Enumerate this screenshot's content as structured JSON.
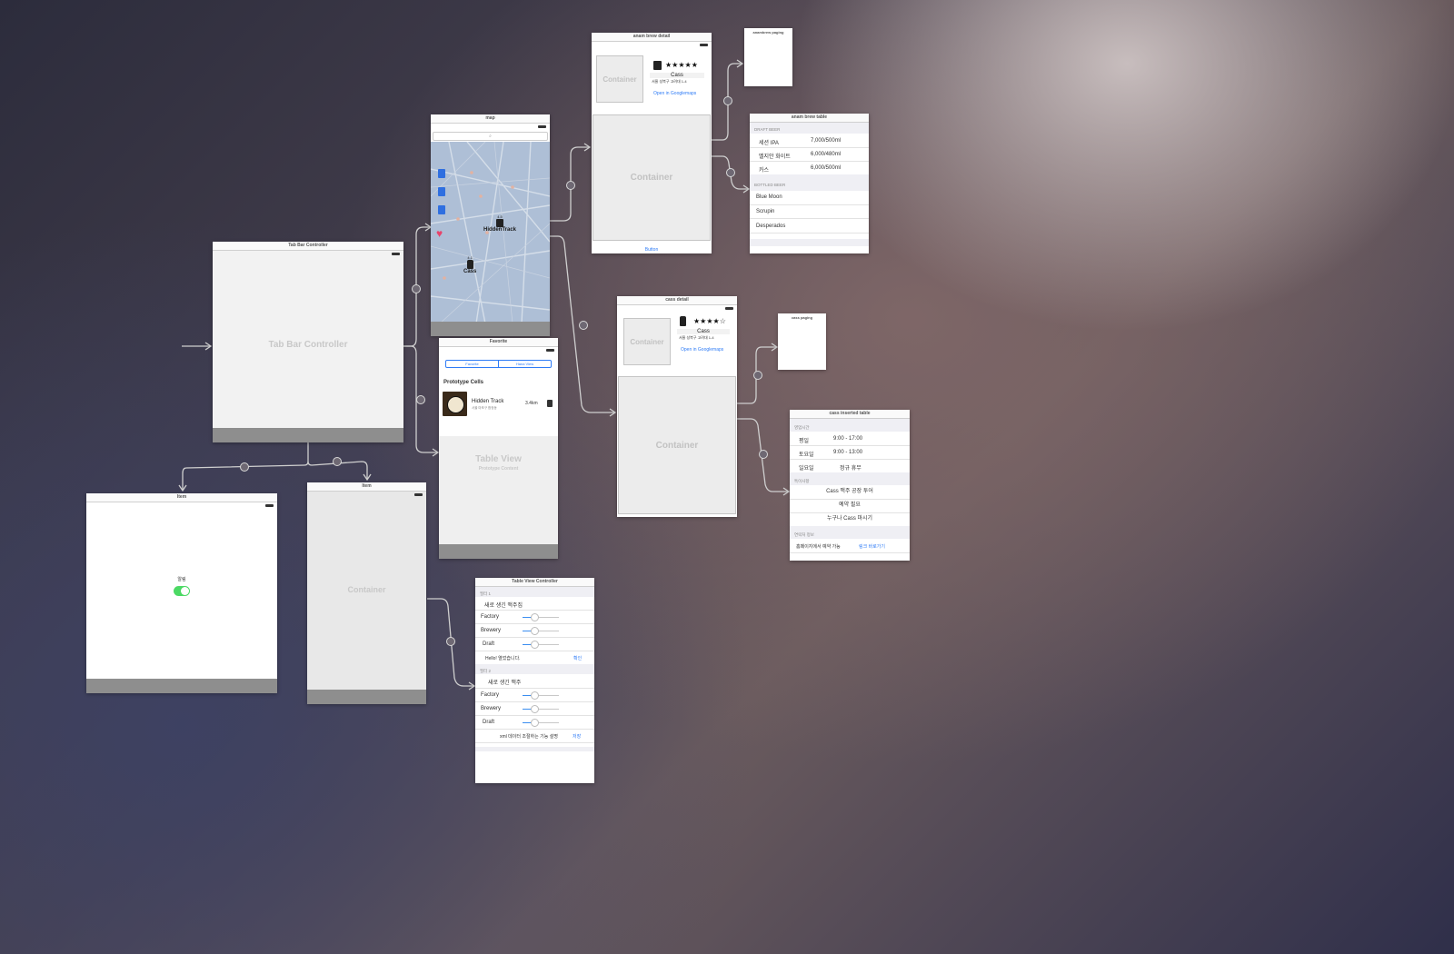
{
  "tab_bar_controller": {
    "title": "Tab Bar Controller",
    "center_label": "Tab Bar Controller"
  },
  "item_settings": {
    "title": "Item",
    "label": "알림",
    "toggle_on": true,
    "toggle_color": "#4cd964"
  },
  "item_container": {
    "title": "Item",
    "container_label": "Container"
  },
  "map": {
    "title": "map",
    "search_icon": "search-icon",
    "pins": [
      {
        "rating": "4.5",
        "name": "HiddenTrack",
        "icon": "beer-glass-icon"
      },
      {
        "rating": "4.1",
        "name": "Cass",
        "icon": "bottle-icon"
      }
    ],
    "heart_icon": "heart-icon",
    "heart_color": "#e8436b"
  },
  "favorite": {
    "title": "Favorite",
    "segments": [
      "Favorite",
      "Hana View"
    ],
    "prototype_cells": "Prototype Cells",
    "cell": {
      "name": "Hidden Track",
      "subtitle": "서울 마포구 합정동",
      "distance": "3.4km",
      "rank": "0"
    },
    "table_view_label": "Table View",
    "table_view_sub": "Prototype Content"
  },
  "anambrew_detail": {
    "title": "anam brew detail",
    "container_label": "Container",
    "rating_stars": "★★★★★",
    "beer_name": "Cass",
    "address": "서울 성북구 고려대 1-4",
    "open_link": "Open in Googlemaps",
    "lower_container_label": "Container",
    "bottom_button": "Button"
  },
  "anambrew_paging": {
    "title": "anambrew paging"
  },
  "anambrew_table": {
    "title": "anam brew table",
    "sections": [
      {
        "header": "DRAFT BEER",
        "rows": [
          [
            "세션 IPA",
            "7,000/500ml"
          ],
          [
            "벨지안 화이트",
            "6,000/480ml"
          ],
          [
            "카스",
            "6,000/500ml"
          ]
        ]
      },
      {
        "header": "BOTTLED BEER",
        "rows": [
          [
            "Blue Moon",
            ""
          ],
          [
            "Scrupin",
            ""
          ],
          [
            "Desperados",
            ""
          ]
        ]
      }
    ]
  },
  "cass_detail": {
    "title": "cass detail",
    "container_label": "Container",
    "rating_stars": "★★★★☆",
    "beer_name": "Cass",
    "address": "서울 성북구 고려대 1-4",
    "open_link": "Open in Googlemaps",
    "lower_container_label": "Container"
  },
  "cass_paging": {
    "title": "cass paging"
  },
  "cass_inserted_table": {
    "title": "cass inserted table",
    "sections": [
      {
        "header": "영업시간",
        "rows": [
          [
            "평일",
            "9:00 - 17:00"
          ],
          [
            "토요일",
            "9:00 - 13:00"
          ],
          [
            "일요일",
            "정규 휴무"
          ]
        ]
      },
      {
        "header": "특이사항",
        "rows": [
          [
            "Cass 맥주 공장 투어"
          ],
          [
            "예약 필요"
          ],
          [
            "누구나 Cass 마시기"
          ]
        ]
      },
      {
        "header": "연락처 정보",
        "rows": [
          [
            "홈페이지에서 예약 가능",
            "링크 바로가기"
          ]
        ]
      }
    ]
  },
  "table_view_controller": {
    "title": "Table View Controller",
    "groups": [
      {
        "header": "필터 1",
        "first": "새로 생긴 맥주집",
        "sliders": [
          {
            "label": "Factory",
            "value": 0.3
          },
          {
            "label": "Brewery",
            "value": 0.3
          },
          {
            "label": "Draft",
            "value": 0.3
          }
        ],
        "footer": "Hello! 열었습니다.",
        "footer_link": "확인"
      },
      {
        "header": "필터 2",
        "first": "새로 생긴 맥주",
        "sliders": [
          {
            "label": "Factory",
            "value": 0.3
          },
          {
            "label": "Brewery",
            "value": 0.3
          },
          {
            "label": "Draft",
            "value": 0.3
          }
        ],
        "footer": "xml 데이터 조절하는 기능 설명",
        "footer_link": "저장"
      }
    ]
  },
  "colors": {
    "accent": "#2f7cf6",
    "map_background": "#aebfd6",
    "footer_gray": "#8e8e8e"
  }
}
